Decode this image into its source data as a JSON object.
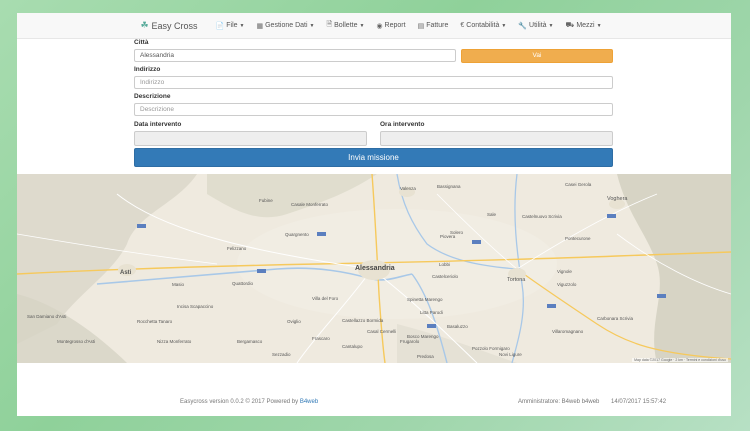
{
  "navbar": {
    "brand": "Easy Cross",
    "items": [
      {
        "label": "File",
        "icon": "file-icon",
        "dropdown": true
      },
      {
        "label": "Gestione Dati",
        "icon": "database-icon",
        "dropdown": true
      },
      {
        "label": "Bollette",
        "icon": "document-icon",
        "dropdown": true
      },
      {
        "label": "Report",
        "icon": "report-icon",
        "dropdown": false
      },
      {
        "label": "Fatture",
        "icon": "invoice-icon",
        "dropdown": false
      },
      {
        "label": "Contabilità",
        "icon": "euro-icon",
        "dropdown": true
      },
      {
        "label": "Utilità",
        "icon": "wrench-icon",
        "dropdown": true
      },
      {
        "label": "Mezzi",
        "icon": "truck-icon",
        "dropdown": true
      }
    ]
  },
  "form": {
    "citta_label": "Città",
    "citta_value": "Alessandria",
    "vai_button": "Vai",
    "indirizzo_label": "Indirizzo",
    "indirizzo_placeholder": "Indirizzo",
    "descrizione_label": "Descrizione",
    "descrizione_placeholder": "Descrizione",
    "data_label": "Data intervento",
    "ora_label": "Ora intervento",
    "submit_label": "Invia missione"
  },
  "map": {
    "main_city": "Alessandria",
    "towns": [
      "Asti",
      "Valenza",
      "Tortona",
      "Voghera",
      "Casale Monferrato",
      "Bassignana",
      "Quargnento",
      "Castellazzo Bormida",
      "Bosco Marengo",
      "Pozzolo Formigaro",
      "Sale",
      "Novi Ligure",
      "Fubine",
      "Felizzano",
      "Solero",
      "Quattordio",
      "Castelnuovo Scrivia",
      "Spinetta Marengo",
      "Litta Parodi",
      "Frugarolo",
      "Piovera",
      "Lobbi",
      "Castelceriolo",
      "Cantalupo",
      "Villa del Foro",
      "Oviglio",
      "Incisa Scapaccino",
      "Nizza Monferrato",
      "Vignole",
      "Casei Gerola",
      "Pontecurone",
      "Viguzzolo",
      "Villaromagnano",
      "Carbonara Scrivia",
      "San Damiano d'Asti",
      "Rocchetta Tanaro",
      "Masio",
      "Bergamasco",
      "Frascaro",
      "Casal Cermelli",
      "Predosa",
      "Basaluzzo",
      "Sezzadio",
      "Montegrosso d'Asti"
    ],
    "attribution": "Map data ©2017 Google · 2 km · Termini e condizioni d'uso"
  },
  "footer": {
    "left_prefix": "Easycross version 0.0.2 © 2017 Powered by",
    "left_link": "B4web",
    "right": "Amministratore: B4web b4web       14/07/2017 15:57:42"
  },
  "colors": {
    "primary": "#337ab7",
    "warning": "#f0ad4e",
    "navbar_bg": "#f8f8f8",
    "map_bg": "#efeadf"
  }
}
